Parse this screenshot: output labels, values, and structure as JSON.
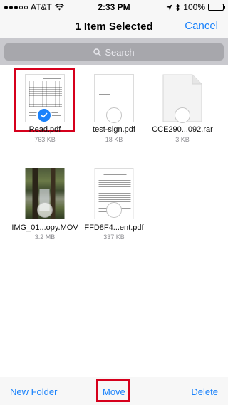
{
  "status_bar": {
    "carrier": "AT&T",
    "time": "2:33 PM",
    "battery": "100%",
    "battery_level": 1.0
  },
  "nav": {
    "title": "1 Item Selected",
    "cancel_label": "Cancel"
  },
  "search": {
    "placeholder": "Search"
  },
  "files": [
    {
      "name": "Read.pdf",
      "size": "763 KB",
      "selected": true
    },
    {
      "name": "test-sign.pdf",
      "size": "18 KB",
      "selected": false
    },
    {
      "name": "CCE290...092.rar",
      "size": "3 KB",
      "selected": false
    },
    {
      "name": "IMG_01...opy.MOV",
      "size": "3.2 MB",
      "selected": false
    },
    {
      "name": "FFD8F4...ent.pdf",
      "size": "337 KB",
      "selected": false
    }
  ],
  "toolbar": {
    "new_folder_label": "New Folder",
    "move_label": "Move",
    "delete_label": "Delete"
  },
  "colors": {
    "accent": "#1a82fb",
    "highlight": "#d6001c",
    "search_bg": "#c9c9ce"
  }
}
